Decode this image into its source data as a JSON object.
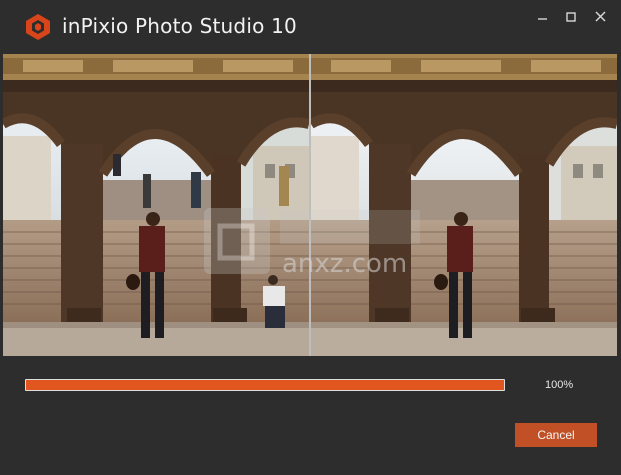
{
  "window": {
    "title": "inPixio Photo Studio 10",
    "accent_color": "#e1561f"
  },
  "window_controls": {
    "minimize_icon": "minimize-icon",
    "maximize_icon": "maximize-icon",
    "close_icon": "close-icon"
  },
  "preview": {
    "left_image": "before-photo",
    "right_image": "after-photo"
  },
  "watermark": {
    "text": "anxz.com"
  },
  "progress": {
    "value": 1.0,
    "label": "100%"
  },
  "buttons": {
    "cancel_label": "Cancel"
  }
}
